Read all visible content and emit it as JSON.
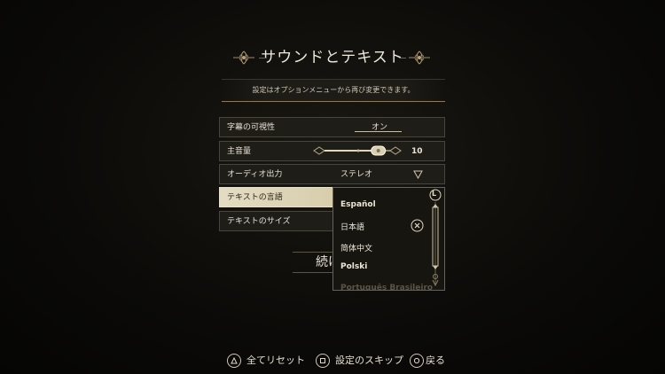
{
  "header": {
    "title": "サウンドとテキスト",
    "subtitle": "設定はオプションメニューから再び変更できます。"
  },
  "settings": {
    "rows": [
      {
        "label": "字幕の可視性",
        "value": "オン"
      },
      {
        "label": "主音量",
        "value": "10",
        "level_percent": 100
      },
      {
        "label": "オーディオ出力",
        "value": "ステレオ"
      },
      {
        "label": "テキストの言語"
      },
      {
        "label": "テキストのサイズ"
      }
    ]
  },
  "continue_label": "続け",
  "language_dropdown": {
    "options": [
      "Español",
      "日本語",
      "简体中文",
      "Polski",
      "Português Brasileiro"
    ],
    "selected": "日本語",
    "scroll_glyph": "L"
  },
  "footer": {
    "reset_label": "全てリセット",
    "skip_label": "設定のスキップ",
    "back_label": "戻る"
  },
  "colors": {
    "accent": "#e0d6b8",
    "selected_row": "#d5cba9",
    "background": "#0b0a08"
  },
  "icons": {
    "reset": "triangle-button-icon",
    "skip": "square-button-icon",
    "back": "circle-button-icon",
    "clear": "cross-button-icon"
  }
}
